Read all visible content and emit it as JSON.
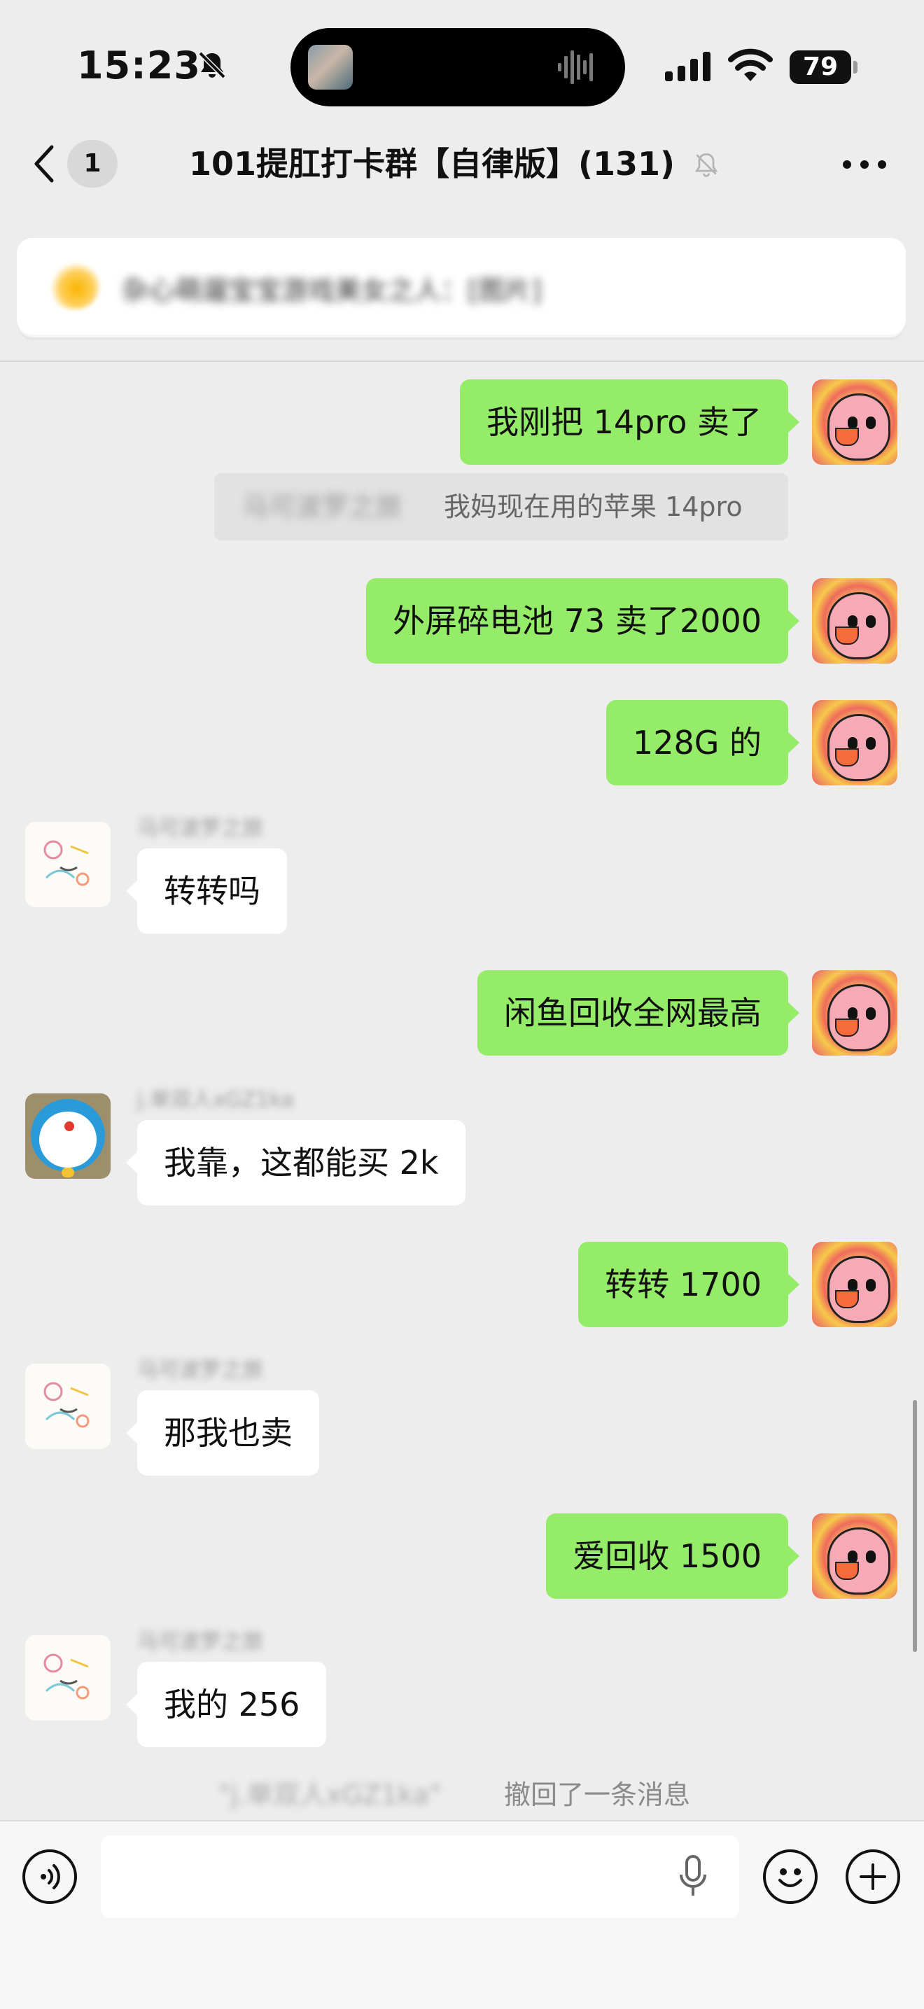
{
  "status_bar": {
    "time": "15:23",
    "battery": "79"
  },
  "header": {
    "unread_count": "1",
    "title": "101提肛打卡群【自律版】(131)"
  },
  "pinned": {
    "text": "杂心萌遛宝宝游戏美女之人：[图片]"
  },
  "messages": [
    {
      "side": "out",
      "text": "我刚把 14pro 卖了"
    },
    {
      "side": "sys",
      "quote_name": "马可波罗之旅",
      "text": "我妈现在用的苹果 14pro"
    },
    {
      "side": "out",
      "text": "外屏碎电池 73 卖了2000"
    },
    {
      "side": "out",
      "text": "128G 的"
    },
    {
      "side": "in",
      "name": "马可波罗之旅",
      "text": "转转吗"
    },
    {
      "side": "out",
      "text": "闲鱼回收全网最高"
    },
    {
      "side": "in",
      "name": "j.单双人xGZ1ka",
      "text": "我靠，这都能买 2k"
    },
    {
      "side": "out",
      "text": "转转 1700"
    },
    {
      "side": "in",
      "name": "马可波罗之旅",
      "text": "那我也卖"
    },
    {
      "side": "out",
      "text": "爱回收 1500"
    },
    {
      "side": "in",
      "name": "马可波罗之旅",
      "text": "我的 256"
    }
  ],
  "recall_notice": {
    "name": "\"j.单双人xGZ1ka\"",
    "text": "撤回了一条消息"
  },
  "input": {
    "placeholder": ""
  },
  "icons": [
    "bell-off-icon",
    "signal-icon",
    "wifi-icon",
    "battery-icon",
    "back-chevron-icon",
    "more-dots-icon",
    "voice-icon",
    "mic-icon",
    "emoji-icon",
    "plus-icon"
  ]
}
